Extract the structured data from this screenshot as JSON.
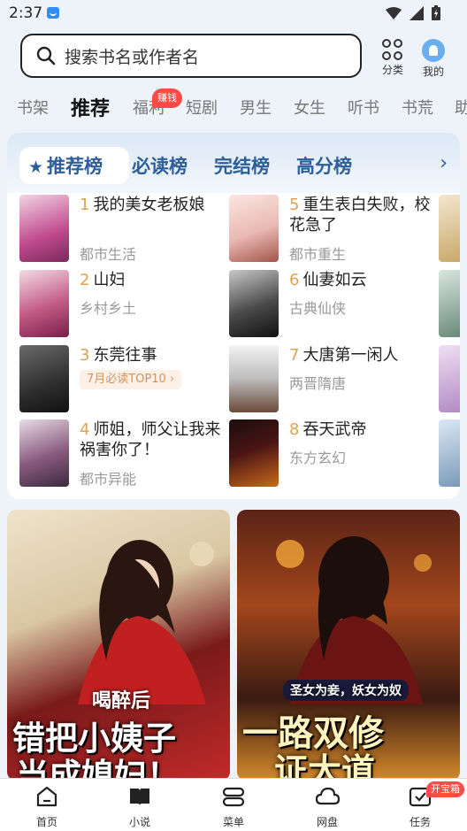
{
  "status": {
    "time": "2:37"
  },
  "search": {
    "placeholder": "搜索书名或作者名"
  },
  "top_actions": {
    "category": "分类",
    "me": "我的"
  },
  "category_tabs": [
    {
      "label": "书架"
    },
    {
      "label": "推荐"
    },
    {
      "label": "福利"
    },
    {
      "label": "短剧"
    },
    {
      "label": "男生"
    },
    {
      "label": "女生"
    },
    {
      "label": "听书"
    },
    {
      "label": "书荒"
    },
    {
      "label": "助"
    }
  ],
  "earn_badge": "赚钱",
  "rank_tabs": [
    {
      "label": "推荐榜"
    },
    {
      "label": "必读榜"
    },
    {
      "label": "完结榜"
    },
    {
      "label": "高分榜"
    }
  ],
  "books": [
    {
      "rank": "1",
      "title": "我的美女老板娘",
      "genre": "都市生活",
      "cover_color": "#c04a8e"
    },
    {
      "rank": "2",
      "title": "山妇",
      "genre": "乡村乡土",
      "cover_color": "#a63a6a"
    },
    {
      "rank": "3",
      "title": "东莞往事",
      "tag": "7月必读TOP10",
      "cover_color": "#3a3a3a"
    },
    {
      "rank": "4",
      "title": "师姐，师父让我来祸害你了！",
      "genre": "都市异能",
      "cover_color": "#6a3a5e"
    },
    {
      "rank": "5",
      "title": "重生表白失败，校花急了",
      "genre": "都市重生",
      "cover_color": "#e9b9b3"
    },
    {
      "rank": "6",
      "title": "仙妻如云",
      "genre": "古典仙侠",
      "cover_color": "#2b2b2b"
    },
    {
      "rank": "7",
      "title": "大唐第一闲人",
      "genre": "两晋隋唐",
      "cover_color": "#bdbdbd"
    },
    {
      "rank": "8",
      "title": "吞天武帝",
      "genre": "东方玄幻",
      "cover_color": "#4a1414"
    }
  ],
  "banners": [
    {
      "caption_top": "喝醉后",
      "caption_main": "错把小姨子",
      "caption_sub": "当成媳妇！"
    },
    {
      "caption_top": "圣女为妾，妖女为奴",
      "caption_main": "一路双修",
      "caption_sub": "证大道"
    }
  ],
  "bottom_nav": [
    {
      "label": "首页"
    },
    {
      "label": "小说"
    },
    {
      "label": "菜单"
    },
    {
      "label": "网盘"
    },
    {
      "label": "任务"
    }
  ],
  "treasure_badge": "开宝箱"
}
